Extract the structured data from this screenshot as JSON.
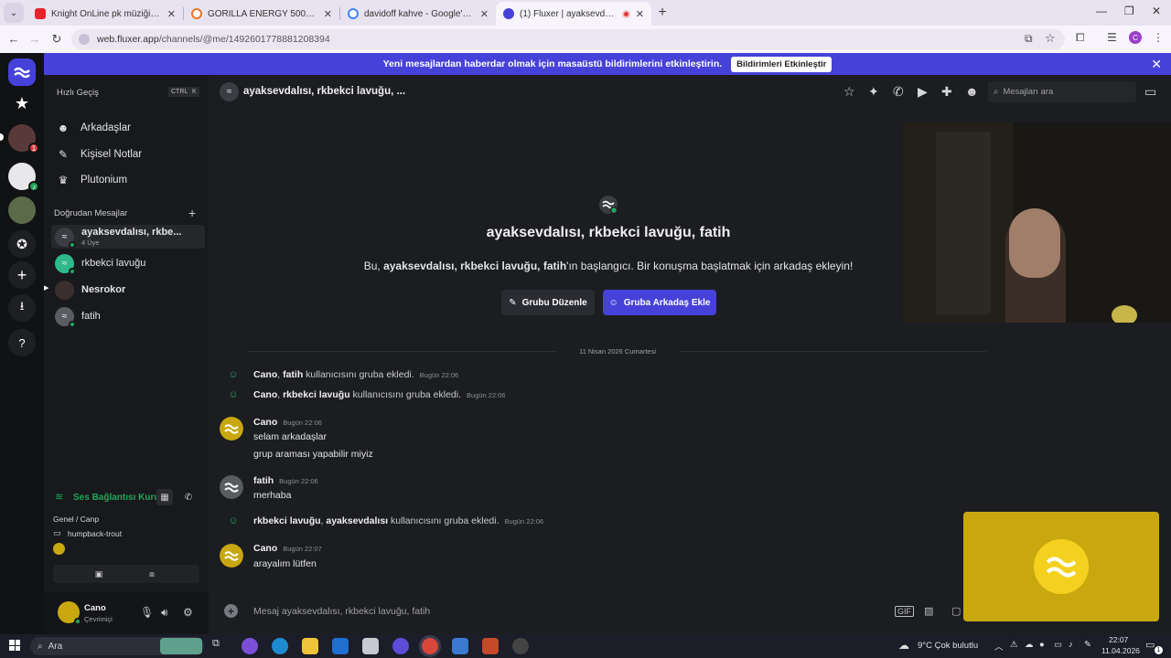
{
  "browser": {
    "tabs": [
      {
        "title": "Knight OnLine pk müziği 2. - Yo",
        "icon_color": "#e8222a"
      },
      {
        "title": "GORİLLA ENERGY 500ml X12 E",
        "icon_color": "#e8762a"
      },
      {
        "title": "davidoff kahve - Google'da Ara",
        "icon_color": "#4285f4"
      },
      {
        "title": "(1) Fluxer | ayaksevdalısı, rkb",
        "icon_color": "#4641d9"
      }
    ],
    "url_host": "web.fluxer.app",
    "url_path": "/channels/@me/1492601778881208394",
    "profile_initial": "C"
  },
  "banner": {
    "text": "Yeni mesajlardan haberdar olmak için masaüstü bildirimlerini etkinleştirin.",
    "button": "Bildirimleri Etkinleştir"
  },
  "rail": {
    "badges": [
      "1"
    ]
  },
  "sidebar": {
    "quick_switch": "Hızlı Geçiş",
    "shortcut_keys": [
      "CTRL",
      "K"
    ],
    "nav": [
      {
        "label": "Arkadaşlar",
        "icon": "friends-icon"
      },
      {
        "label": "Kişisel Notlar",
        "icon": "notes-icon"
      },
      {
        "label": "Plutonium",
        "icon": "crown-icon"
      }
    ],
    "dm_header": "Doğrudan Mesajlar",
    "dms": [
      {
        "name": "ayaksevdalısı, rkbe...",
        "sub": "4 Üye"
      },
      {
        "name": "rkbekci lavuğu",
        "sub": ""
      },
      {
        "name": "Nesrokor",
        "sub": ""
      },
      {
        "name": "fatih",
        "sub": ""
      }
    ],
    "voice": {
      "status": "Ses Bağlantısı Kuruldu",
      "channel": "Genel / Canp",
      "member": "humpback-trout"
    },
    "user": {
      "name": "Cano",
      "status": "Çevrimiçi"
    }
  },
  "channel": {
    "title": "ayaksevdalısı, rkbekci lavuğu, ...",
    "search_placeholder": "Mesajları ara",
    "intro_title": "ayaksevdalısı, rkbekci lavuğu, fatih",
    "intro_prefix": "Bu, ",
    "intro_bold": "ayaksevdalısı, rkbekci lavuğu, fatih",
    "intro_suffix": "'ın başlangıcı. Bir konuşma başlatmak için arkadaş ekleyin!",
    "edit_group": "Grubu Düzenle",
    "add_friend": "Gruba Arkadaş Ekle",
    "date_divider": "11 Nisan 2026 Cumartesi",
    "messages": [
      {
        "kind": "system",
        "actor": "Cano",
        "target": "fatih",
        "action": " kullanıcısını gruba ekledi.",
        "time": "Bugün 22:06"
      },
      {
        "kind": "system",
        "actor": "Cano",
        "target": "rkbekci lavuğu",
        "action": " kullanıcısını gruba ekledi.",
        "time": "Bugün 22:06"
      },
      {
        "kind": "user",
        "author": "Cano",
        "time": "Bugün 22:06",
        "lines": [
          "selam arkadaşlar",
          "grup araması yapabilir miyiz"
        ]
      },
      {
        "kind": "user",
        "author": "fatih",
        "time": "Bugün 22:06",
        "lines": [
          "merhaba"
        ]
      },
      {
        "kind": "system",
        "actor": "rkbekci lavuğu",
        "target": "ayaksevdalısı",
        "action": " kullanıcısını gruba ekledi.",
        "time": "Bugün 22:06"
      },
      {
        "kind": "user",
        "author": "Cano",
        "time": "Bugün 22:07",
        "lines": [
          "arayalım lütfen"
        ]
      }
    ],
    "composer_placeholder": "Mesaj ayaksevdalısı, rkbekci lavuğu, fatih"
  },
  "taskbar": {
    "search": "Ara",
    "weather": "9°C  Çok bulutlu",
    "time": "22:07",
    "date": "11.04.2026",
    "notif_count": "1"
  },
  "colors": {
    "accent": "#4641d9",
    "online": "#23a55a",
    "cano_avatar": "#c9a80f",
    "fluxer_teal": "#2fb98a"
  }
}
